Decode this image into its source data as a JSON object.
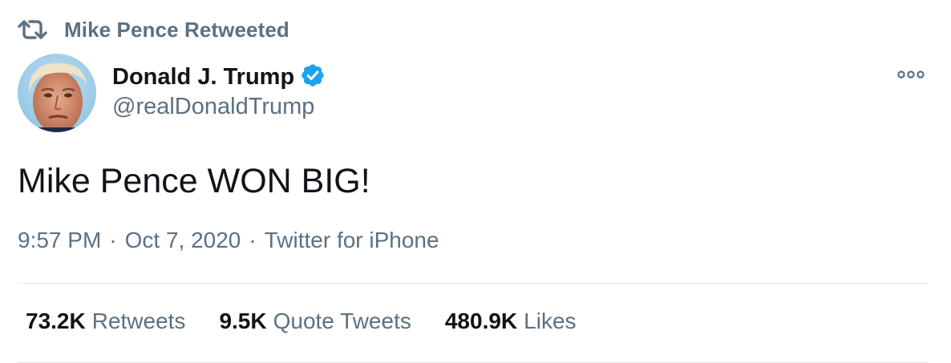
{
  "retweet_context": {
    "icon": "retweet-icon",
    "label": "Mike Pence Retweeted"
  },
  "author": {
    "display_name": "Donald J. Trump",
    "handle": "@realDonaldTrump",
    "verified": true,
    "verified_icon": "verified-badge-icon",
    "avatar_icon": "avatar"
  },
  "more_icon": "more-options-icon",
  "tweet": {
    "text": "Mike Pence WON BIG!"
  },
  "meta": {
    "time": "9:57 PM",
    "separator": "·",
    "date": "Oct 7, 2020",
    "source": "Twitter for iPhone"
  },
  "stats": [
    {
      "value": "73.2K",
      "label": "Retweets"
    },
    {
      "value": "9.5K",
      "label": "Quote Tweets"
    },
    {
      "value": "480.9K",
      "label": "Likes"
    }
  ],
  "colors": {
    "text_primary": "#0f1419",
    "text_secondary": "#5b7083",
    "verified_blue": "#1da1f2",
    "divider": "#e1e8ed"
  }
}
